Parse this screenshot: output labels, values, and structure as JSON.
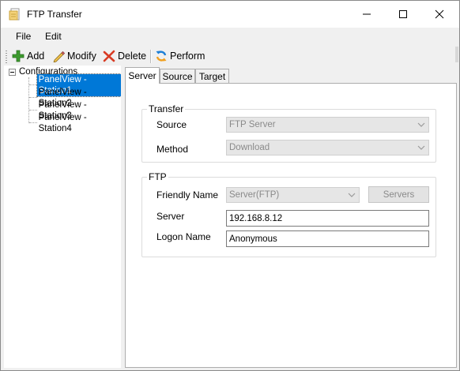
{
  "window": {
    "title": "FTP Transfer"
  },
  "menu": {
    "file": "File",
    "edit": "Edit"
  },
  "toolbar": {
    "add": "Add",
    "modify": "Modify",
    "delete": "Delete",
    "perform": "Perform"
  },
  "tree": {
    "root": "Configurations",
    "items": [
      {
        "label": "PanelView - Station1",
        "selected": true
      },
      {
        "label": "PanelView - Station2",
        "selected": false
      },
      {
        "label": "PanelView - Station3",
        "selected": false
      },
      {
        "label": "PanelView - Station4",
        "selected": false
      }
    ]
  },
  "tabs": {
    "server": "Server",
    "source": "Source",
    "target": "Target",
    "active": "Server"
  },
  "transfer_group": {
    "title": "Transfer",
    "source_label": "Source",
    "source_value": "FTP Server",
    "method_label": "Method",
    "method_value": "Download"
  },
  "ftp_group": {
    "title": "FTP",
    "friendly_name_label": "Friendly Name",
    "friendly_name_value": "Server(FTP)",
    "servers_button": "Servers",
    "server_label": "Server",
    "server_value": "192.168.8.12",
    "logon_label": "Logon Name",
    "logon_value": "Anonymous"
  },
  "colors": {
    "selection": "#0078d7",
    "add_icon": "#3c9a2e",
    "delete_icon": "#d83b24",
    "perform_icon": "#1e7fd6"
  }
}
